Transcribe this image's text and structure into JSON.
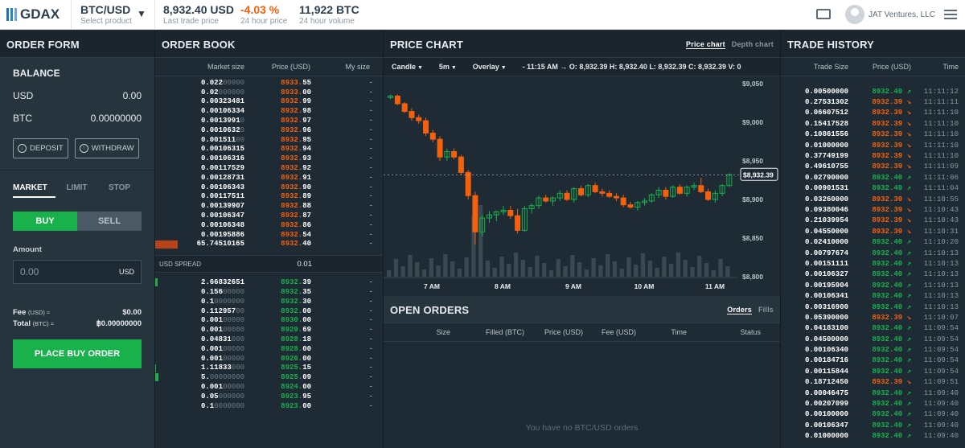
{
  "header": {
    "logo": "GDAX",
    "product": "BTC/USD",
    "product_sub": "Select product",
    "last_price": "8,932.40 USD",
    "last_price_label": "Last trade price",
    "change": "-4.03 %",
    "change_label": "24 hour price",
    "volume": "11,922 BTC",
    "volume_label": "24 hour volume",
    "user": "JAT Ventures, LLC"
  },
  "order_form": {
    "title": "ORDER FORM",
    "balance": "BALANCE",
    "usd_label": "USD",
    "usd": "0.00",
    "btc_label": "BTC",
    "btc": "0.00000000",
    "deposit": "DEPOSIT",
    "withdraw": "WITHDRAW",
    "tabs": [
      "MARKET",
      "LIMIT",
      "STOP"
    ],
    "buy": "BUY",
    "sell": "SELL",
    "amount_label": "Amount",
    "amount_placeholder": "0.00",
    "amount_unit": "USD",
    "fee_label": "Fee",
    "fee_unit": "(USD) ≈",
    "fee": "$0.00",
    "total_label": "Total",
    "total_unit": "(BTC) ≈",
    "total": "฿0.00000000",
    "place": "PLACE BUY ORDER"
  },
  "order_book": {
    "title": "ORDER BOOK",
    "cols": [
      "Market size",
      "Price (USD)",
      "My size"
    ],
    "asks": [
      {
        "size": "0.022",
        "zeros": "00000",
        "price": "8933.",
        "dec": "55",
        "my": "-",
        "bar": 0
      },
      {
        "size": "0.02",
        "zeros": "000000",
        "price": "8933.",
        "dec": "00",
        "my": "-",
        "bar": 0
      },
      {
        "size": "0.00323481",
        "zeros": "",
        "price": "8932.",
        "dec": "99",
        "my": "-",
        "bar": 0
      },
      {
        "size": "0.00106334",
        "zeros": "",
        "price": "8932.",
        "dec": "98",
        "my": "-",
        "bar": 0
      },
      {
        "size": "0.0013991",
        "zeros": "0",
        "price": "8932.",
        "dec": "97",
        "my": "-",
        "bar": 0
      },
      {
        "size": "0.0010632",
        "zeros": "0",
        "price": "8932.",
        "dec": "96",
        "my": "-",
        "bar": 0
      },
      {
        "size": "0.001511",
        "zeros": "00",
        "price": "8932.",
        "dec": "95",
        "my": "-",
        "bar": 0
      },
      {
        "size": "0.00106315",
        "zeros": "",
        "price": "8932.",
        "dec": "94",
        "my": "-",
        "bar": 0
      },
      {
        "size": "0.00106316",
        "zeros": "",
        "price": "8932.",
        "dec": "93",
        "my": "-",
        "bar": 0
      },
      {
        "size": "0.00117529",
        "zeros": "",
        "price": "8932.",
        "dec": "92",
        "my": "-",
        "bar": 0
      },
      {
        "size": "0.00128731",
        "zeros": "",
        "price": "8932.",
        "dec": "91",
        "my": "-",
        "bar": 0
      },
      {
        "size": "0.00106343",
        "zeros": "",
        "price": "8932.",
        "dec": "90",
        "my": "-",
        "bar": 0
      },
      {
        "size": "0.00117511",
        "zeros": "",
        "price": "8932.",
        "dec": "89",
        "my": "-",
        "bar": 0
      },
      {
        "size": "0.00139907",
        "zeros": "",
        "price": "8932.",
        "dec": "88",
        "my": "-",
        "bar": 0
      },
      {
        "size": "0.00106347",
        "zeros": "",
        "price": "8932.",
        "dec": "87",
        "my": "-",
        "bar": 0
      },
      {
        "size": "0.00106348",
        "zeros": "",
        "price": "8932.",
        "dec": "86",
        "my": "-",
        "bar": 0
      },
      {
        "size": "0.00195886",
        "zeros": "",
        "price": "8932.",
        "dec": "54",
        "my": "-",
        "bar": 0
      },
      {
        "size": "65.74510165",
        "zeros": "",
        "price": "8932.",
        "dec": "40",
        "my": "-",
        "bar": 1
      }
    ],
    "spread_label": "USD SPREAD",
    "spread": "0.01",
    "bids": [
      {
        "size": "2.66832651",
        "zeros": "",
        "price": "8932.",
        "dec": "39",
        "my": "-",
        "bar": 0.1
      },
      {
        "size": "0.156",
        "zeros": "00000",
        "price": "8932.",
        "dec": "35",
        "my": "-",
        "bar": 0
      },
      {
        "size": "0.1",
        "zeros": "0000000",
        "price": "8932.",
        "dec": "30",
        "my": "-",
        "bar": 0
      },
      {
        "size": "0.112957",
        "zeros": "00",
        "price": "8932.",
        "dec": "00",
        "my": "-",
        "bar": 0
      },
      {
        "size": "0.001",
        "zeros": "00000",
        "price": "8930.",
        "dec": "00",
        "my": "-",
        "bar": 0
      },
      {
        "size": "0.001",
        "zeros": "00000",
        "price": "8929.",
        "dec": "69",
        "my": "-",
        "bar": 0
      },
      {
        "size": "0.04831",
        "zeros": "000",
        "price": "8928.",
        "dec": "18",
        "my": "-",
        "bar": 0
      },
      {
        "size": "0.001",
        "zeros": "00000",
        "price": "8928.",
        "dec": "00",
        "my": "-",
        "bar": 0
      },
      {
        "size": "0.001",
        "zeros": "00000",
        "price": "8926.",
        "dec": "00",
        "my": "-",
        "bar": 0
      },
      {
        "size": "1.11833",
        "zeros": "000",
        "price": "8925.",
        "dec": "15",
        "my": "-",
        "bar": 0.05
      },
      {
        "size": "5.",
        "zeros": "00000000",
        "price": "8925.",
        "dec": "09",
        "my": "-",
        "bar": 0.15
      },
      {
        "size": "0.001",
        "zeros": "00000",
        "price": "8924.",
        "dec": "00",
        "my": "-",
        "bar": 0
      },
      {
        "size": "0.05",
        "zeros": "000000",
        "price": "8923.",
        "dec": "95",
        "my": "-",
        "bar": 0
      },
      {
        "size": "0.1",
        "zeros": "0000000",
        "price": "8923.",
        "dec": "00",
        "my": "-",
        "bar": 0
      }
    ]
  },
  "price_chart": {
    "title": "PRICE CHART",
    "tabs": [
      "Price chart",
      "Depth chart"
    ],
    "controls": [
      "Candle",
      "5m",
      "Overlay"
    ],
    "ohlc": "- 11:15 AM →  O: 8,932.39  H: 8,932.40  L: 8,932.39  C: 8,932.39  V: 0",
    "current": "$8,932.39",
    "y_ticks": [
      "$9,050",
      "$9,000",
      "$8,950",
      "$8,900",
      "$8,850",
      "$8,800"
    ],
    "x_ticks": [
      "7 AM",
      "8 AM",
      "9 AM",
      "10 AM",
      "11 AM"
    ]
  },
  "chart_data": {
    "type": "candlestick",
    "ylim": [
      8800,
      9050
    ],
    "candles": [
      {
        "o": 9032,
        "h": 9036,
        "l": 9030,
        "c": 9034
      },
      {
        "o": 9034,
        "h": 9036,
        "l": 9022,
        "c": 9024
      },
      {
        "o": 9024,
        "h": 9026,
        "l": 9012,
        "c": 9014
      },
      {
        "o": 9014,
        "h": 9018,
        "l": 9002,
        "c": 9006
      },
      {
        "o": 9006,
        "h": 9010,
        "l": 8998,
        "c": 9002
      },
      {
        "o": 9002,
        "h": 9006,
        "l": 8982,
        "c": 8986
      },
      {
        "o": 8986,
        "h": 8990,
        "l": 8974,
        "c": 8978
      },
      {
        "o": 8978,
        "h": 8982,
        "l": 8950,
        "c": 8955
      },
      {
        "o": 8955,
        "h": 8966,
        "l": 8950,
        "c": 8962
      },
      {
        "o": 8962,
        "h": 8966,
        "l": 8952,
        "c": 8955
      },
      {
        "o": 8955,
        "h": 8958,
        "l": 8932,
        "c": 8935
      },
      {
        "o": 8935,
        "h": 8938,
        "l": 8900,
        "c": 8905
      },
      {
        "o": 8905,
        "h": 8910,
        "l": 8842,
        "c": 8858
      },
      {
        "o": 8858,
        "h": 8880,
        "l": 8852,
        "c": 8876
      },
      {
        "o": 8876,
        "h": 8885,
        "l": 8870,
        "c": 8880
      },
      {
        "o": 8880,
        "h": 8886,
        "l": 8872,
        "c": 8884
      },
      {
        "o": 8884,
        "h": 8892,
        "l": 8880,
        "c": 8886
      },
      {
        "o": 8886,
        "h": 8892,
        "l": 8875,
        "c": 8879
      },
      {
        "o": 8879,
        "h": 8888,
        "l": 8856,
        "c": 8860
      },
      {
        "o": 8860,
        "h": 8892,
        "l": 8858,
        "c": 8888
      },
      {
        "o": 8888,
        "h": 8895,
        "l": 8882,
        "c": 8892
      },
      {
        "o": 8892,
        "h": 8905,
        "l": 8888,
        "c": 8902
      },
      {
        "o": 8902,
        "h": 8906,
        "l": 8896,
        "c": 8898
      },
      {
        "o": 8898,
        "h": 8904,
        "l": 8892,
        "c": 8902
      },
      {
        "o": 8902,
        "h": 8912,
        "l": 8898,
        "c": 8908
      },
      {
        "o": 8908,
        "h": 8912,
        "l": 8898,
        "c": 8900
      },
      {
        "o": 8900,
        "h": 8916,
        "l": 8896,
        "c": 8914
      },
      {
        "o": 8914,
        "h": 8918,
        "l": 8904,
        "c": 8906
      },
      {
        "o": 8906,
        "h": 8920,
        "l": 8903,
        "c": 8918
      },
      {
        "o": 8918,
        "h": 8922,
        "l": 8908,
        "c": 8910
      },
      {
        "o": 8910,
        "h": 8914,
        "l": 8904,
        "c": 8908
      },
      {
        "o": 8908,
        "h": 8912,
        "l": 8902,
        "c": 8904
      },
      {
        "o": 8904,
        "h": 8908,
        "l": 8898,
        "c": 8902
      },
      {
        "o": 8902,
        "h": 8906,
        "l": 8890,
        "c": 8893
      },
      {
        "o": 8893,
        "h": 8897,
        "l": 8888,
        "c": 8890
      },
      {
        "o": 8890,
        "h": 8898,
        "l": 8886,
        "c": 8896
      },
      {
        "o": 8896,
        "h": 8902,
        "l": 8892,
        "c": 8898
      },
      {
        "o": 8898,
        "h": 8908,
        "l": 8896,
        "c": 8906
      },
      {
        "o": 8906,
        "h": 8916,
        "l": 8902,
        "c": 8912
      },
      {
        "o": 8912,
        "h": 8916,
        "l": 8900,
        "c": 8904
      },
      {
        "o": 8904,
        "h": 8918,
        "l": 8902,
        "c": 8916
      },
      {
        "o": 8916,
        "h": 8920,
        "l": 8906,
        "c": 8908
      },
      {
        "o": 8908,
        "h": 8918,
        "l": 8904,
        "c": 8916
      },
      {
        "o": 8916,
        "h": 8922,
        "l": 8912,
        "c": 8918
      },
      {
        "o": 8918,
        "h": 8928,
        "l": 8908,
        "c": 8910
      },
      {
        "o": 8910,
        "h": 8914,
        "l": 8898,
        "c": 8900
      },
      {
        "o": 8900,
        "h": 8912,
        "l": 8896,
        "c": 8908
      },
      {
        "o": 8908,
        "h": 8920,
        "l": 8904,
        "c": 8918
      },
      {
        "o": 8918,
        "h": 8934,
        "l": 8916,
        "c": 8932
      }
    ]
  },
  "open_orders": {
    "title": "OPEN ORDERS",
    "tabs": [
      "Orders",
      "Fills"
    ],
    "cols": [
      "Size",
      "Filled (BTC)",
      "Price (USD)",
      "Fee (USD)",
      "Time",
      "Status"
    ],
    "empty": "You have no BTC/USD orders"
  },
  "trade_history": {
    "title": "TRADE HISTORY",
    "cols": [
      "Trade Size",
      "Price (USD)",
      "Time"
    ],
    "trades": [
      {
        "s": "0.00500000",
        "p": "8932.40",
        "d": "up",
        "t": "11:11:12"
      },
      {
        "s": "0.27531302",
        "p": "8932.39",
        "d": "dn",
        "t": "11:11:11"
      },
      {
        "s": "0.06607512",
        "p": "8932.39",
        "d": "dn",
        "t": "11:11:10"
      },
      {
        "s": "0.15417528",
        "p": "8932.39",
        "d": "dn",
        "t": "11:11:10"
      },
      {
        "s": "0.10861556",
        "p": "8932.39",
        "d": "dn",
        "t": "11:11:10"
      },
      {
        "s": "0.01000000",
        "p": "8932.39",
        "d": "dn",
        "t": "11:11:10"
      },
      {
        "s": "0.37749199",
        "p": "8932.39",
        "d": "dn",
        "t": "11:11:10"
      },
      {
        "s": "0.49610755",
        "p": "8932.39",
        "d": "dn",
        "t": "11:11:09"
      },
      {
        "s": "0.02790000",
        "p": "8932.40",
        "d": "up",
        "t": "11:11:06"
      },
      {
        "s": "0.00901531",
        "p": "8932.40",
        "d": "up",
        "t": "11:11:04"
      },
      {
        "s": "0.03260000",
        "p": "8932.39",
        "d": "dn",
        "t": "11:10:55"
      },
      {
        "s": "0.09380046",
        "p": "8932.39",
        "d": "dn",
        "t": "11:10:43"
      },
      {
        "s": "0.21039954",
        "p": "8932.39",
        "d": "dn",
        "t": "11:10:43"
      },
      {
        "s": "0.04550000",
        "p": "8932.39",
        "d": "dn",
        "t": "11:10:31"
      },
      {
        "s": "0.02410000",
        "p": "8932.40",
        "d": "up",
        "t": "11:10:20"
      },
      {
        "s": "0.00797674",
        "p": "8932.40",
        "d": "up",
        "t": "11:10:13"
      },
      {
        "s": "0.00151111",
        "p": "8932.40",
        "d": "up",
        "t": "11:10:13"
      },
      {
        "s": "0.00106327",
        "p": "8932.40",
        "d": "up",
        "t": "11:10:13"
      },
      {
        "s": "0.00195904",
        "p": "8932.40",
        "d": "up",
        "t": "11:10:13"
      },
      {
        "s": "0.00106341",
        "p": "8932.40",
        "d": "up",
        "t": "11:10:13"
      },
      {
        "s": "0.00316900",
        "p": "8932.40",
        "d": "up",
        "t": "11:10:13"
      },
      {
        "s": "0.05390000",
        "p": "8932.39",
        "d": "dn",
        "t": "11:10:07"
      },
      {
        "s": "0.04183100",
        "p": "8932.40",
        "d": "up",
        "t": "11:09:54"
      },
      {
        "s": "0.04500000",
        "p": "8932.40",
        "d": "up",
        "t": "11:09:54"
      },
      {
        "s": "0.00106340",
        "p": "8932.40",
        "d": "up",
        "t": "11:09:54"
      },
      {
        "s": "0.00184716",
        "p": "8932.40",
        "d": "up",
        "t": "11:09:54"
      },
      {
        "s": "0.00115844",
        "p": "8932.40",
        "d": "up",
        "t": "11:09:54"
      },
      {
        "s": "0.18712450",
        "p": "8932.39",
        "d": "dn",
        "t": "11:09:51"
      },
      {
        "s": "0.00046475",
        "p": "8932.40",
        "d": "up",
        "t": "11:09:40"
      },
      {
        "s": "0.00207099",
        "p": "8932.40",
        "d": "up",
        "t": "11:09:40"
      },
      {
        "s": "0.00100000",
        "p": "8932.40",
        "d": "up",
        "t": "11:09:40"
      },
      {
        "s": "0.00106347",
        "p": "8932.40",
        "d": "up",
        "t": "11:09:40"
      },
      {
        "s": "0.01000000",
        "p": "8932.40",
        "d": "up",
        "t": "11:09:40"
      }
    ]
  },
  "colors": {
    "up": "#18b14b",
    "down": "#f4600c",
    "bg": "#1e2b34"
  }
}
